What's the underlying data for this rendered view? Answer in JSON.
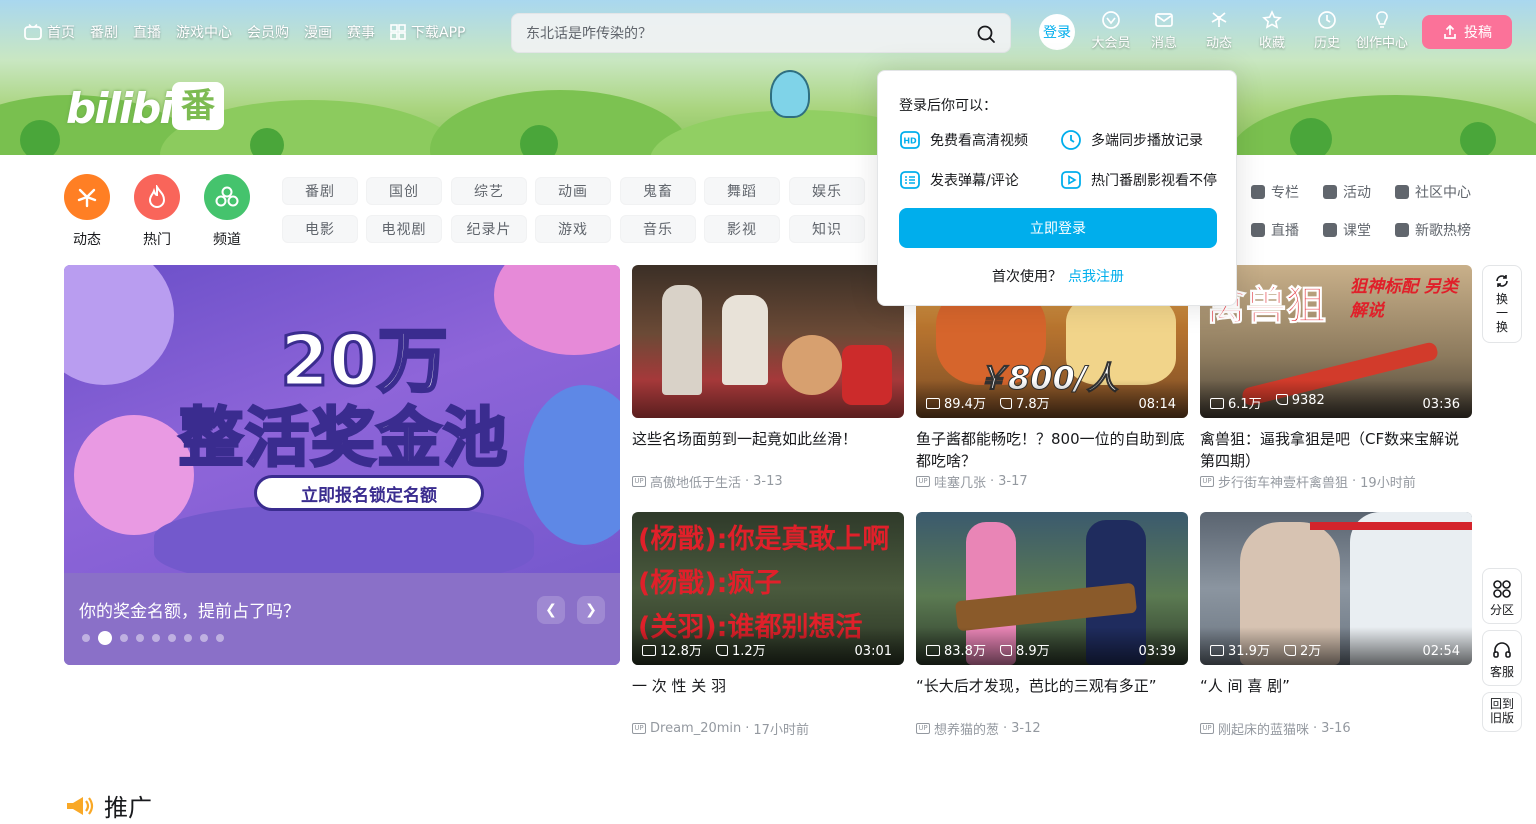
{
  "nav": {
    "home": "首页",
    "items": [
      "番剧",
      "直播",
      "游戏中心",
      "会员购",
      "漫画",
      "赛事"
    ],
    "download": "下载APP"
  },
  "search": {
    "placeholder": "东北话是咋传染的？"
  },
  "right_nav": {
    "login": "登录",
    "items": [
      "大会员",
      "消息",
      "动态",
      "收藏",
      "历史",
      "创作中心"
    ],
    "upload": "投稿"
  },
  "logo_text": "bilibili",
  "big_channels": [
    {
      "label": "动态",
      "color": "#ff7f24"
    },
    {
      "label": "热门",
      "color": "#f9655a"
    },
    {
      "label": "频道",
      "color": "#45c36d"
    }
  ],
  "channel_chips_row1": [
    "番剧",
    "国创",
    "综艺",
    "动画",
    "鬼畜",
    "舞蹈",
    "娱乐"
  ],
  "channel_chips_row2": [
    "电影",
    "电视剧",
    "纪录片",
    "游戏",
    "音乐",
    "影视",
    "知识"
  ],
  "right_channels_row1": [
    "专栏",
    "活动",
    "社区中心"
  ],
  "right_channels_row2": [
    "直播",
    "课堂",
    "新歌热榜"
  ],
  "carousel": {
    "headline": "20万",
    "subheadline": "整活奖金池",
    "pill": "立即报名锁定名额",
    "caption": "你的奖金名额，提前占了吗？",
    "dots": 9,
    "active_dot": 1
  },
  "videos": [
    {
      "title": "这些名场面剪到一起竟如此丝滑！",
      "up": "高傲地低于生活",
      "date": "3-13",
      "views": "",
      "likes": "",
      "duration": ""
    },
    {
      "title": "鱼子酱都能畅吃！？800一位的自助到底都吃啥？",
      "up": "哇塞几张",
      "date": "3-17",
      "views": "89.4万",
      "likes": "7.8万",
      "duration": "08:14",
      "thumb_text": "￥800/人"
    },
    {
      "title": "禽兽狙：逼我拿狙是吧（CF数来宝解说第四期）",
      "up": "步行街车神壹杆禽兽狙",
      "date": "19小时前",
      "views": "6.1万",
      "likes": "9382",
      "duration": "03:36",
      "thumb_text": "禽兽狙",
      "thumb_text2": "狙神标配 另类解说"
    },
    {
      "title": "一 次 性 关 羽",
      "up": "Dream_20min",
      "date": "17小时前",
      "views": "12.8万",
      "likes": "1.2万",
      "duration": "03:01",
      "thumb_lines": [
        "(杨戬):你是真敢上啊",
        "(杨戬):疯子",
        "(关羽):谁都别想活"
      ]
    },
    {
      "title": "“长大后才发现，芭比的三观有多正”",
      "up": "想养猫的葱",
      "date": "3-12",
      "views": "83.8万",
      "likes": "8.9万",
      "duration": "03:39"
    },
    {
      "title": "“人 间 喜 剧”",
      "up": "刚起床的蓝猫咪",
      "date": "3-16",
      "views": "31.9万",
      "likes": "2万",
      "duration": "02:54"
    }
  ],
  "popup": {
    "title": "登录后你可以：",
    "features": [
      "免费看高清视频",
      "多端同步播放记录",
      "发表弹幕/评论",
      "热门番剧影视看不停"
    ],
    "login_button": "立即登录",
    "register_prompt": "首次使用？",
    "register_link": "点我注册"
  },
  "side_tools": {
    "refresh": "换一换",
    "section": "分区",
    "service": "客服",
    "old_version": "回到旧版"
  },
  "promo_title": "推广",
  "colors": {
    "accent": "#00aeec",
    "pink": "#fb7299"
  }
}
